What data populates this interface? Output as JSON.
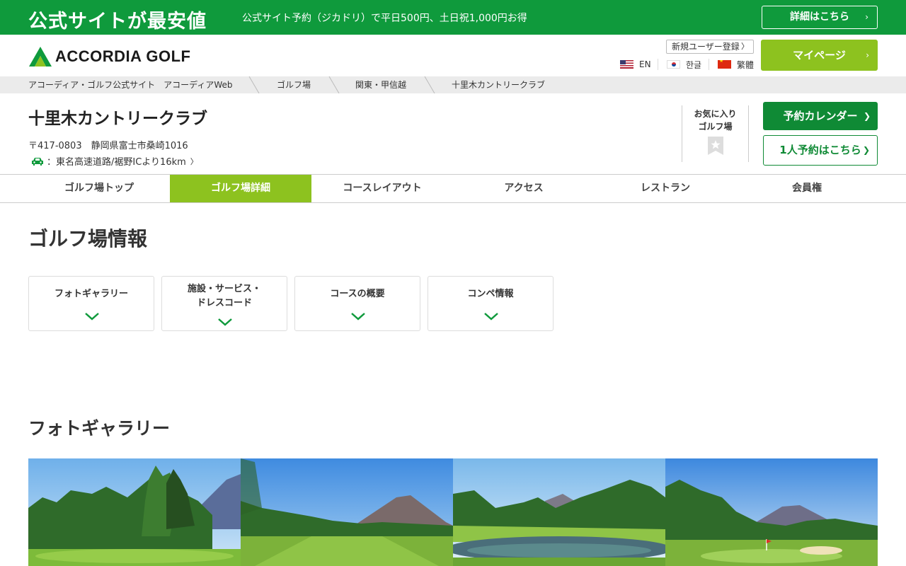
{
  "banner": {
    "title": "公式サイトが最安値",
    "subtitle": "公式サイト予約（ジカドリ）で平日500円、土日祝1,000円お得",
    "details_button": "詳細はこちら"
  },
  "header": {
    "logo_text": "ACCORDIA GOLF",
    "signup_link": "新規ユーザー登録",
    "languages": [
      {
        "label": "EN",
        "flag": "us-flag-icon"
      },
      {
        "label": "한글",
        "flag": "kr-flag-icon"
      },
      {
        "label": "繁體",
        "flag": "tw-flag-icon"
      }
    ],
    "mypage_button": "マイページ"
  },
  "breadcrumb": [
    "アコーディア・ゴルフ公式サイト　アコーディアWeb",
    "ゴルフ場",
    "関東・甲信越",
    "十里木カントリークラブ"
  ],
  "course": {
    "name": "十里木カントリークラブ",
    "address": "〒417-0803　静岡県富士市桑崎1016",
    "access_prefix": "：",
    "access": "東名高速道路/裾野ICより16km",
    "favorite_line1": "お気に入り",
    "favorite_line2": "ゴルフ場",
    "calendar_button": "予約カレンダー",
    "solo_button": "1人予約はこちら"
  },
  "tabs": [
    {
      "label": "ゴルフ場トップ",
      "active": false
    },
    {
      "label": "ゴルフ場詳細",
      "active": true
    },
    {
      "label": "コースレイアウト",
      "active": false
    },
    {
      "label": "アクセス",
      "active": false
    },
    {
      "label": "レストラン",
      "active": false
    },
    {
      "label": "会員権",
      "active": false
    }
  ],
  "info": {
    "title": "ゴルフ場情報",
    "cards": [
      {
        "line1": "フォトギャラリー",
        "line2": ""
      },
      {
        "line1": "施設・サービス・",
        "line2": "ドレスコード"
      },
      {
        "line1": "コースの概要",
        "line2": ""
      },
      {
        "line1": "コンペ情報",
        "line2": ""
      }
    ]
  },
  "gallery": {
    "title": "フォトギャラリー"
  },
  "colors": {
    "brand_green": "#0f9a3c",
    "accent_lime": "#8dc21f",
    "dark_green": "#0f8a35"
  }
}
